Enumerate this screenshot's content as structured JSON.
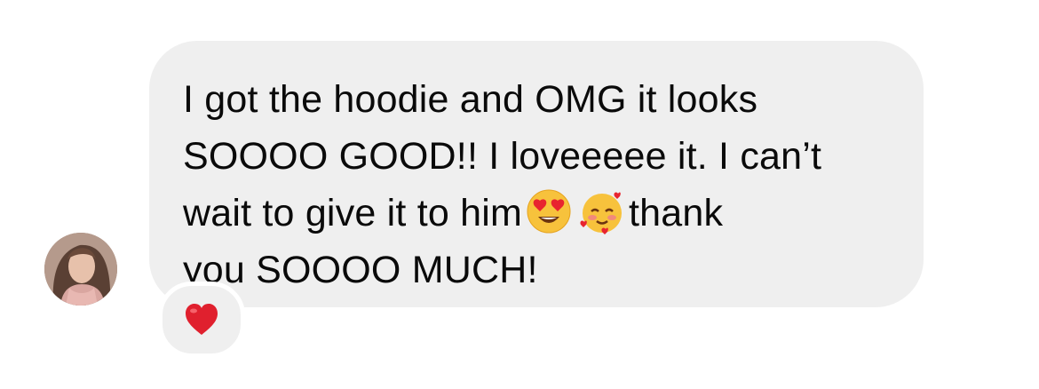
{
  "message": {
    "line1": "I got the hoodie and OMG it looks",
    "line2": "SOOOO GOOD!! I loveeeee it. I can’t",
    "line3_before": "wait to give it to him",
    "line3_after": "thank",
    "line4": "you SOOOO MUCH!",
    "emojis": [
      "heart-eyes-emoji",
      "smiling-face-with-hearts-emoji"
    ]
  },
  "reaction": {
    "icon": "red-heart-icon",
    "color": "#e0202e"
  },
  "colors": {
    "bubble": "#efefef",
    "text": "#0a0a0a"
  }
}
